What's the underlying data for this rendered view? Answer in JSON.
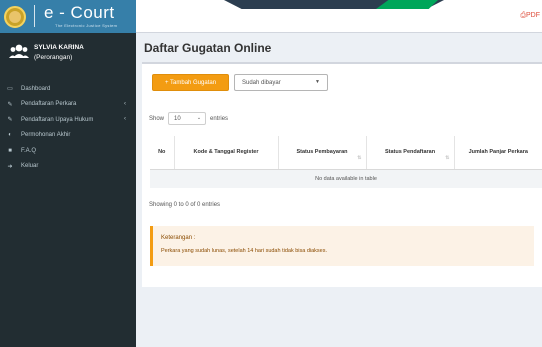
{
  "header": {
    "brand": "e - Court",
    "tagline": "The Electronic Justice System",
    "pdf_label": "PDF"
  },
  "user": {
    "name": "SYLVIA KARINA",
    "role": "(Perorangan)"
  },
  "sidebar": {
    "items": [
      {
        "label": "Dashboard",
        "icon": "monitor-icon"
      },
      {
        "label": "Pendaftaran Perkara",
        "icon": "edit-icon",
        "has_submenu": true
      },
      {
        "label": "Pendaftaran Upaya Hukum",
        "icon": "edit-icon",
        "has_submenu": true
      },
      {
        "label": "Permohonan Akhir",
        "icon": "toggle-icon"
      },
      {
        "label": "F.A.Q",
        "icon": "book-icon"
      },
      {
        "label": "Keluar",
        "icon": "logout-icon"
      }
    ]
  },
  "main": {
    "page_title": "Daftar Gugatan Online",
    "add_button_label": "+ Tambah Gugatan",
    "filter_select_value": "Sudah dibayar",
    "show_label": "Show",
    "entries_label": "entries",
    "page_length_value": "10",
    "table": {
      "columns": [
        {
          "label": "No",
          "sortable": false
        },
        {
          "label": "Kode & Tanggal Register",
          "sortable": false
        },
        {
          "label": "Status Pembayaran",
          "sortable": true
        },
        {
          "label": "Status Pendaftaran",
          "sortable": true
        },
        {
          "label": "Jumlah Panjar Perkara",
          "sortable": false
        }
      ],
      "empty_message": "No data available in table"
    },
    "info_text": "Showing 0 to 0 of 0 entries",
    "callout": {
      "title": "Keterangan :",
      "text": "Perkara yang sudah lunas, setelah 14 hari sudah tidak bisa diakses."
    }
  },
  "colors": {
    "sidebar_bg": "#222d32",
    "logo_bg": "#367fa9",
    "accent_orange": "#f39c12",
    "pdf_red": "#dd4b39"
  }
}
